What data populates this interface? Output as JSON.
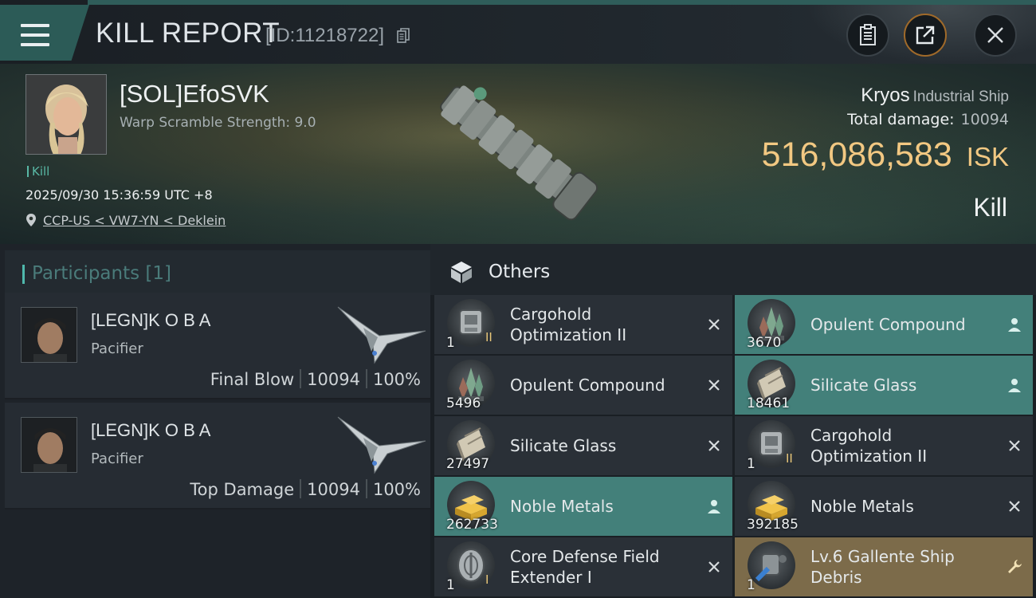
{
  "header": {
    "title": "KILL REPORT",
    "report_id": "[ID:11218722]"
  },
  "victim": {
    "name": "[SOL]EfoSVK",
    "warp_scramble": "Warp Scramble Strength: 9.0",
    "kill_tag": "Kill",
    "datetime": "2025/09/30 15:36:59 UTC +8",
    "location": "CCP-US < VW7-YN < Deklein",
    "ship_name": "Kryos",
    "ship_class": "Industrial Ship",
    "total_damage_label": "Total damage:",
    "total_damage": "10094",
    "isk_value": "516,086,583",
    "isk_unit": "ISK",
    "result": "Kill"
  },
  "participants": {
    "label": "Participants [1]",
    "rows": [
      {
        "name": "[LEGN]K O B A",
        "ship": "Pacifier",
        "role": "Final Blow",
        "damage": "10094",
        "percent": "100%"
      },
      {
        "name": "[LEGN]K O B A",
        "ship": "Pacifier",
        "role": "Top Damage",
        "damage": "10094",
        "percent": "100%"
      }
    ]
  },
  "others": {
    "label": "Others",
    "items": [
      {
        "name": "Cargohold Optimization II",
        "qty": "1",
        "meta": "II",
        "status": "destroyed",
        "icon": "cargohold-module-icon",
        "bg": "#2a3037"
      },
      {
        "name": "Opulent Compound",
        "qty": "3670",
        "meta": "",
        "status": "dropped",
        "icon": "crystal-icon",
        "bg": "#43807a"
      },
      {
        "name": "Opulent Compound",
        "qty": "5496",
        "meta": "",
        "status": "destroyed",
        "icon": "crystal-icon",
        "bg": "#2a3037"
      },
      {
        "name": "Silicate Glass",
        "qty": "18461",
        "meta": "",
        "status": "dropped",
        "icon": "glass-icon",
        "bg": "#43807a"
      },
      {
        "name": "Silicate Glass",
        "qty": "27497",
        "meta": "",
        "status": "destroyed",
        "icon": "glass-icon",
        "bg": "#2a3037"
      },
      {
        "name": "Cargohold Optimization II",
        "qty": "1",
        "meta": "II",
        "status": "destroyed",
        "icon": "cargohold-module-icon",
        "bg": "#2a3037"
      },
      {
        "name": "Noble Metals",
        "qty": "262733",
        "meta": "",
        "status": "dropped",
        "icon": "gold-bars-icon",
        "bg": "#43807a"
      },
      {
        "name": "Noble Metals",
        "qty": "392185",
        "meta": "",
        "status": "destroyed",
        "icon": "gold-bars-icon",
        "bg": "#2a3037"
      },
      {
        "name": "Core Defense Field Extender I",
        "qty": "1",
        "meta": "I",
        "status": "destroyed",
        "icon": "shield-module-icon",
        "bg": "#2a3037"
      },
      {
        "name": "Lv.6 Gallente Ship Debris",
        "qty": "1",
        "meta": "",
        "status": "salvage",
        "icon": "ship-debris-icon",
        "bg": "#7c6b4a"
      }
    ]
  },
  "colors": {
    "accent_teal": "#4fb8ac",
    "isk_gold": "#f2c882",
    "dropped_row": "#43807a",
    "salvage_row": "#7c6b4a"
  }
}
